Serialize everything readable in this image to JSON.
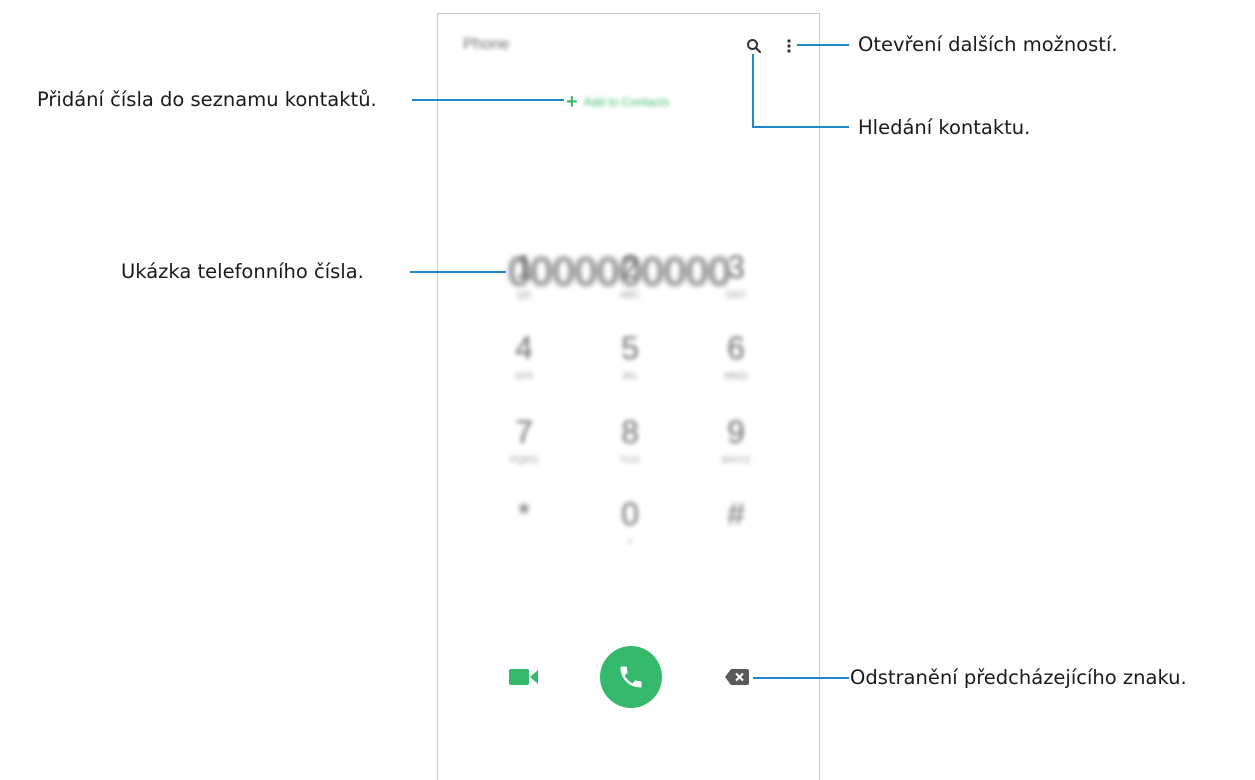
{
  "app": {
    "title": "Phone",
    "add_contact_label": "Add to Contacts",
    "number": "0000000000"
  },
  "icons": {
    "search": "search-icon",
    "more": "more-options-icon",
    "add": "plus-icon",
    "video": "video-call-icon",
    "call": "phone-call-icon",
    "backspace": "backspace-icon"
  },
  "keypad": [
    {
      "digit": "1",
      "letters": "QD"
    },
    {
      "digit": "2",
      "letters": "ABC"
    },
    {
      "digit": "3",
      "letters": "DEF"
    },
    {
      "digit": "4",
      "letters": "GHI"
    },
    {
      "digit": "5",
      "letters": "JKL"
    },
    {
      "digit": "6",
      "letters": "MNO"
    },
    {
      "digit": "7",
      "letters": "PQRS"
    },
    {
      "digit": "8",
      "letters": "TUV"
    },
    {
      "digit": "9",
      "letters": "WXYZ"
    },
    {
      "digit": "*",
      "letters": ""
    },
    {
      "digit": "0",
      "letters": "+"
    },
    {
      "digit": "#",
      "letters": ""
    }
  ],
  "callouts": {
    "more_options": "Otevření dalších možností.",
    "search": "Hledání kontaktu.",
    "add_number": "Přidání čísla do seznamu kontaktů.",
    "preview": "Ukázka telefonního čísla.",
    "delete": "Odstranění předcházejícího znaku."
  },
  "colors": {
    "accent": "#35b96d",
    "leader": "#1e88c8",
    "frame": "#c8c8c8"
  }
}
